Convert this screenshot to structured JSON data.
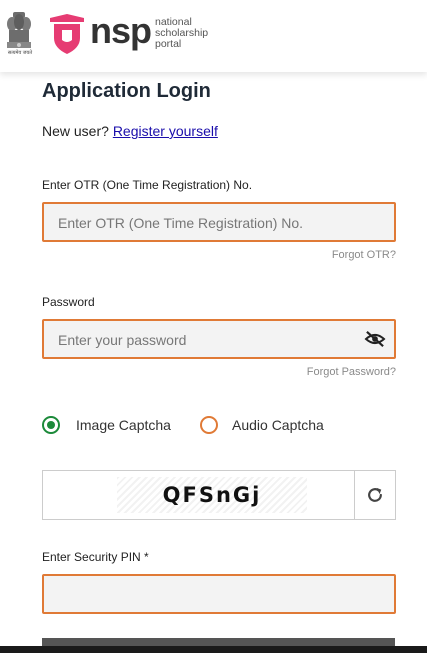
{
  "header": {
    "emblem_tagline": "सत्यमेव जयते",
    "logo_text": "nsp",
    "logo_sub": [
      "national",
      "scholarship",
      "portal"
    ]
  },
  "page": {
    "title": "Application Login",
    "new_user_prefix": "New user?",
    "register_link": "Register yourself"
  },
  "otr": {
    "label": "Enter OTR (One Time Registration) No.",
    "placeholder": "Enter OTR (One Time Registration) No.",
    "value": "",
    "forgot_link": "Forgot OTR?"
  },
  "password": {
    "label": "Password",
    "placeholder": "Enter your password",
    "value": "",
    "forgot_link": "Forgot Password?"
  },
  "captcha": {
    "options": [
      {
        "label": "Image Captcha",
        "selected": true
      },
      {
        "label": "Audio Captcha",
        "selected": false
      }
    ],
    "image_text": "QFSnGj",
    "refresh_icon": "refresh-icon"
  },
  "security_pin": {
    "label": "Enter Security PIN *",
    "value": ""
  },
  "colors": {
    "accent_border": "#e07a36",
    "radio_selected": "#1c8a3a",
    "link": "#1a0dab",
    "logo_pink": "#e63c73"
  }
}
